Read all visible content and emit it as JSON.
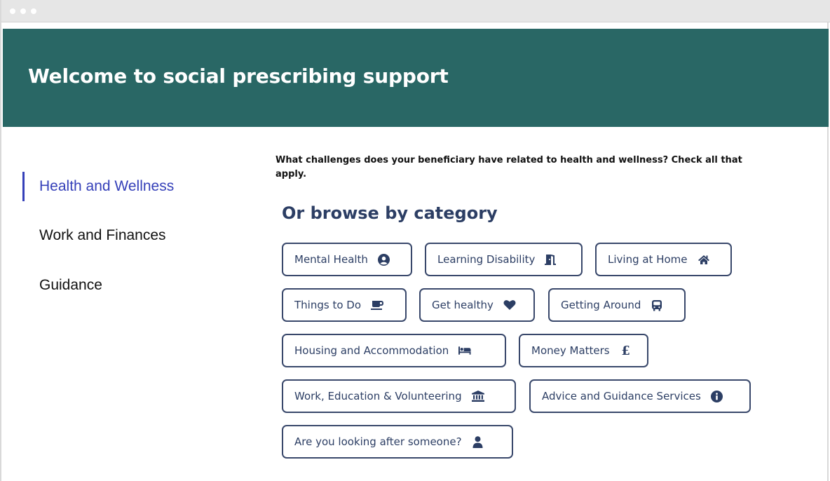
{
  "header": {
    "title": "Welcome to social prescribing support"
  },
  "sidebar": {
    "items": [
      {
        "label": "Health and Wellness",
        "active": true
      },
      {
        "label": "Work and Finances",
        "active": false
      },
      {
        "label": "Guidance",
        "active": false
      }
    ]
  },
  "main": {
    "question": "What challenges does your beneficiary have related to health and wellness? Check all that apply.",
    "browse_title": "Or browse by category",
    "categories": [
      {
        "label": "Mental Health",
        "icon": "user-circle-icon"
      },
      {
        "label": "Learning Disability",
        "icon": "door-icon"
      },
      {
        "label": "Living at Home",
        "icon": "home-icon"
      },
      {
        "label": "Things to Do",
        "icon": "coffee-icon"
      },
      {
        "label": "Get healthy",
        "icon": "heart-icon"
      },
      {
        "label": "Getting Around",
        "icon": "bus-icon"
      },
      {
        "label": "Housing and Accommodation",
        "icon": "bed-icon"
      },
      {
        "label": "Money Matters",
        "icon": "pound-icon"
      },
      {
        "label": "Work, Education & Volunteering",
        "icon": "institution-icon"
      },
      {
        "label": "Advice and Guidance Services",
        "icon": "info-icon"
      },
      {
        "label": "Are you looking after someone?",
        "icon": "person-icon"
      }
    ]
  },
  "colors": {
    "header_bg": "#296765",
    "active_nav": "#3540b9",
    "button_border": "#39486b",
    "button_text": "#2c3e64"
  }
}
